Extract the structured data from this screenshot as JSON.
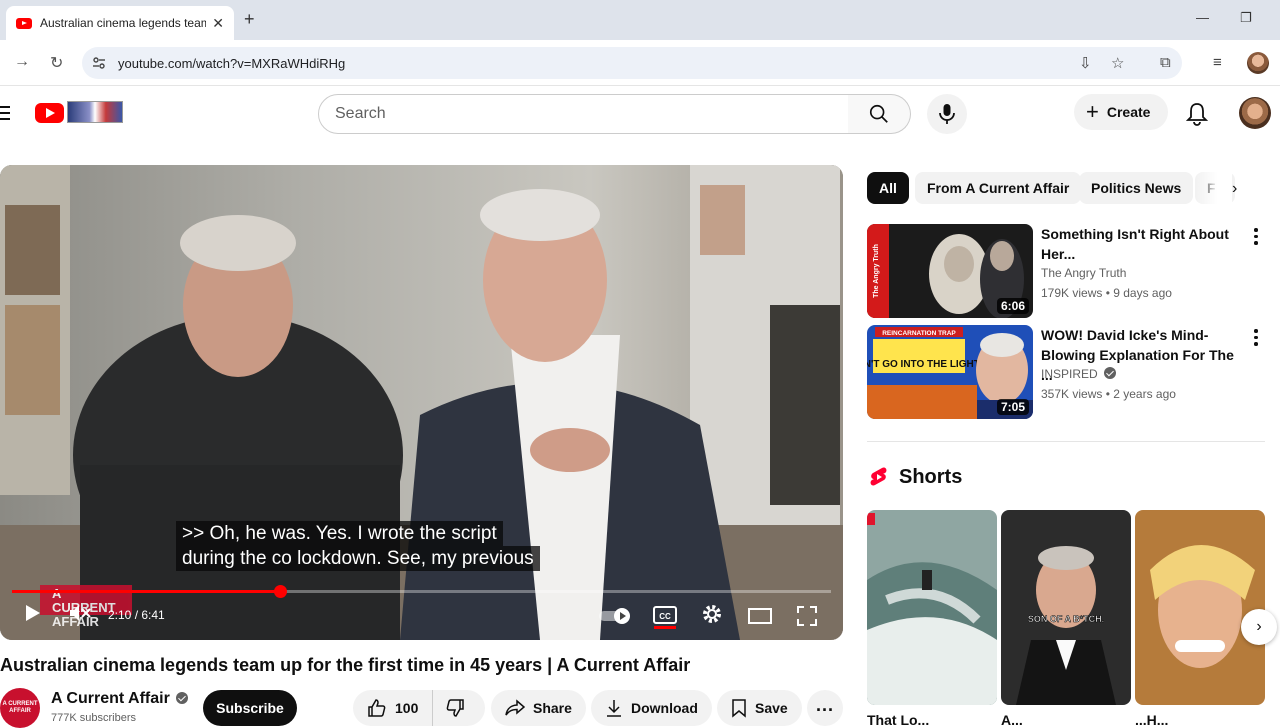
{
  "browser": {
    "tab_title": "Australian cinema legends team",
    "url": "youtube.com/watch?v=MXRaWHdiRHg"
  },
  "header": {
    "search_placeholder": "Search",
    "create_label": "Create"
  },
  "player": {
    "caption_line1": ">> Oh, he was. Yes. I wrote the script",
    "caption_line2": "during the co lockdown. See, my previous",
    "time": "2:10 / 6:41",
    "progress": 0.327,
    "watermark": "A CURRENT AFFAIR"
  },
  "video": {
    "title": "Australian cinema legends team up for the first time in 45 years | A Current Affair",
    "channel_name": "A Current Affair",
    "channel_avatar_text": "A CURRENT AFFAIR",
    "subscribers": "777K subscribers",
    "subscribe_label": "Subscribe",
    "likes": "100",
    "share_label": "Share",
    "download_label": "Download",
    "save_label": "Save"
  },
  "chips": {
    "all": "All",
    "from_channel": "From A Current Affair",
    "politics": "Politics News",
    "partial": "F"
  },
  "recommendations": [
    {
      "title": "Something Isn't Right About Her...",
      "channel": "The Angry Truth",
      "meta": "179K views • 9 days ago",
      "duration": "6:06",
      "thumb_text": "The Angry Truth"
    },
    {
      "title": "WOW! David Icke's Mind-Blowing Explanation For The ...",
      "channel": "INSPIRED",
      "meta": "357K views • 2 years ago",
      "duration": "7:05",
      "thumb_badge": "REINCARNATION TRAP",
      "thumb_text": "DON'T GO INTO THE LIGHT?!"
    }
  ],
  "shorts": {
    "title": "Shorts",
    "items": [
      {
        "label": "That Lo..."
      },
      {
        "label": "A...",
        "overlay": "SON OF A B*TCH."
      },
      {
        "label": "...H..."
      }
    ]
  },
  "colors": {
    "brand_red": "#ff0000",
    "chip_active": "#0f0f0f",
    "pill_bg": "#f2f2f2"
  }
}
